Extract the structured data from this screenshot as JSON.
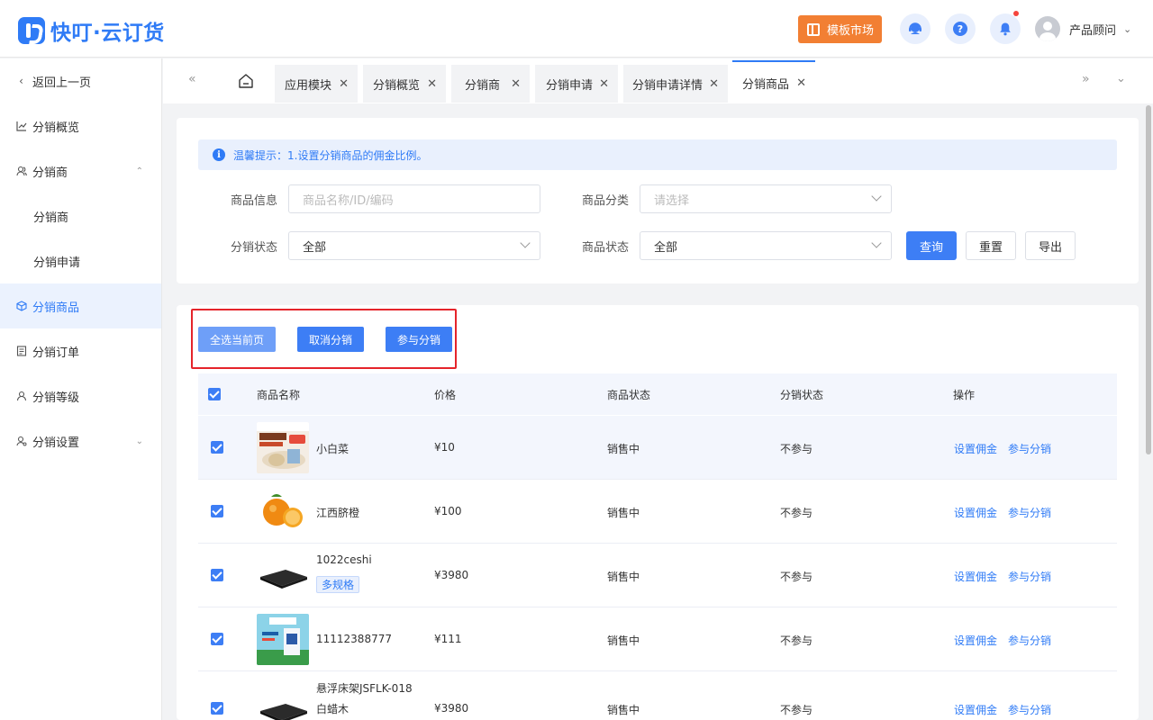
{
  "header": {
    "brand": "快叮·云订货",
    "template_market": "模板市场",
    "user_name": "产品顾问"
  },
  "sidebar": {
    "back": "返回上一页",
    "items": [
      {
        "label": "分销概览"
      },
      {
        "label": "分销商"
      },
      {
        "label": "分销商"
      },
      {
        "label": "分销申请"
      },
      {
        "label": "分销商品"
      },
      {
        "label": "分销订单"
      },
      {
        "label": "分销等级"
      },
      {
        "label": "分销设置"
      }
    ]
  },
  "tabs": [
    {
      "label": "应用模块"
    },
    {
      "label": "分销概览"
    },
    {
      "label": "分销商"
    },
    {
      "label": "分销申请"
    },
    {
      "label": "分销申请详情"
    },
    {
      "label": "分销商品"
    }
  ],
  "tip": "温馨提示：1.设置分销商品的佣金比例。",
  "filters": {
    "product_info_label": "商品信息",
    "product_info_placeholder": "商品名称/ID/编码",
    "category_label": "商品分类",
    "category_placeholder": "请选择",
    "dist_status_label": "分销状态",
    "dist_status_value": "全部",
    "product_status_label": "商品状态",
    "product_status_value": "全部",
    "query": "查询",
    "reset": "重置",
    "export": "导出"
  },
  "actions": {
    "select_page": "全选当前页",
    "cancel_dist": "取消分销",
    "join_dist": "参与分销"
  },
  "table": {
    "columns": [
      "商品名称",
      "价格",
      "商品状态",
      "分销状态",
      "操作"
    ],
    "rows": [
      {
        "name": "小白菜",
        "price": "¥10",
        "status": "销售中",
        "dist": "不参与",
        "op1": "设置佣金",
        "op2": "参与分销"
      },
      {
        "name": "江西脐橙",
        "price": "¥100",
        "status": "销售中",
        "dist": "不参与",
        "op1": "设置佣金",
        "op2": "参与分销"
      },
      {
        "name": "1022ceshi",
        "tag": "多规格",
        "price": "¥3980",
        "status": "销售中",
        "dist": "不参与",
        "op1": "设置佣金",
        "op2": "参与分销"
      },
      {
        "name": "11112388777",
        "price": "¥111",
        "status": "销售中",
        "dist": "不参与",
        "op1": "设置佣金",
        "op2": "参与分销"
      },
      {
        "name": "悬浮床架JSFLK-018",
        "name2": "白蜡木",
        "price": "¥3980",
        "status": "销售中",
        "dist": "不参与",
        "op1": "设置佣金",
        "op2": "参与分销"
      }
    ]
  },
  "colors": {
    "primary": "#3d7ef5",
    "accent_orange": "#f27f33",
    "highlight_red": "#e5242b"
  }
}
